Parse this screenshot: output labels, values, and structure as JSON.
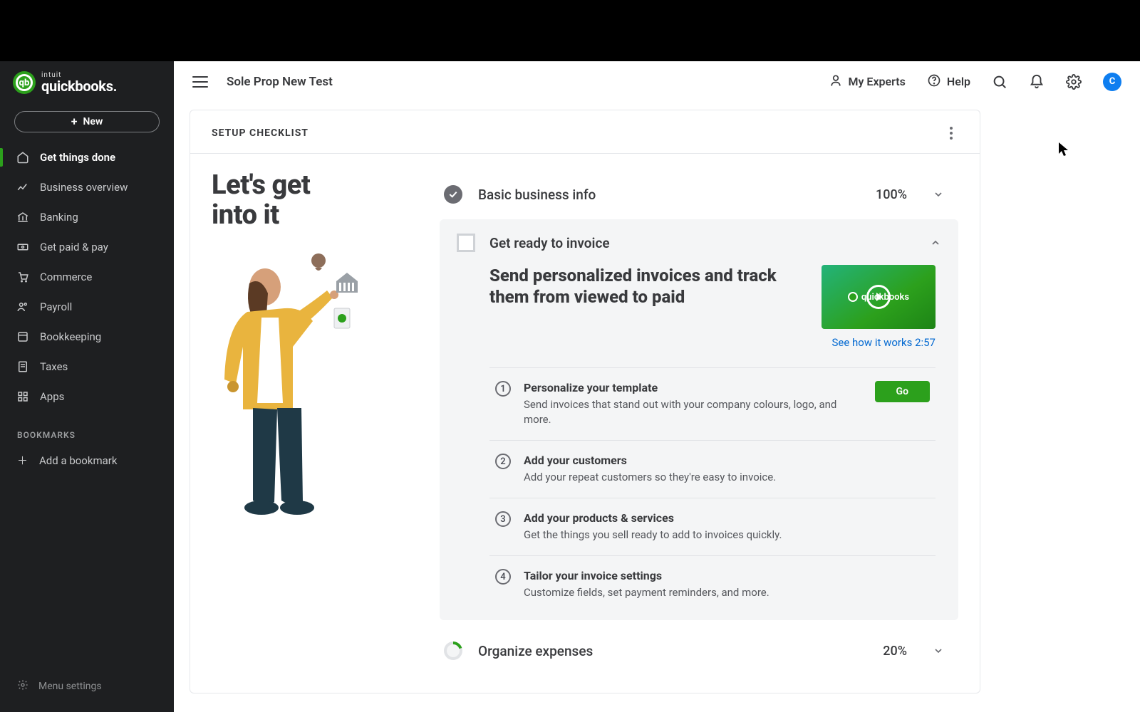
{
  "brand": {
    "intuit": "intuit",
    "name": "quickbooks.",
    "logo_text": "qb"
  },
  "new_button": "New",
  "sidebar": {
    "items": [
      {
        "label": "Get things done"
      },
      {
        "label": "Business overview"
      },
      {
        "label": "Banking"
      },
      {
        "label": "Get paid & pay"
      },
      {
        "label": "Commerce"
      },
      {
        "label": "Payroll"
      },
      {
        "label": "Bookkeeping"
      },
      {
        "label": "Taxes"
      },
      {
        "label": "Apps"
      }
    ],
    "bookmarks_header": "BOOKMARKS",
    "add_bookmark": "Add a bookmark",
    "menu_settings": "Menu settings"
  },
  "header": {
    "company": "Sole Prop New Test",
    "experts": "My Experts",
    "help": "Help",
    "avatar_initial": "C"
  },
  "checklist": {
    "title": "SETUP CHECKLIST",
    "hero_line1": "Let's get",
    "hero_line2": "into it",
    "sections": {
      "basic": {
        "label": "Basic business info",
        "pct": "100%"
      },
      "invoice": {
        "label": "Get ready to invoice",
        "hero": "Send personalized invoices and track them from viewed to paid",
        "video_brand": "quickbooks",
        "video_link": "See how it works 2:57",
        "steps": [
          {
            "n": "1",
            "title": "Personalize your template",
            "desc": "Send invoices that stand out with your company colours, logo, and more.",
            "go": "Go"
          },
          {
            "n": "2",
            "title": "Add your customers",
            "desc": "Add your repeat customers so they're easy to invoice."
          },
          {
            "n": "3",
            "title": "Add your products & services",
            "desc": "Get the things you sell ready to add to invoices quickly."
          },
          {
            "n": "4",
            "title": "Tailor your invoice settings",
            "desc": "Customize fields, set payment reminders, and more."
          }
        ]
      },
      "expenses": {
        "label": "Organize expenses",
        "pct": "20%"
      }
    }
  }
}
